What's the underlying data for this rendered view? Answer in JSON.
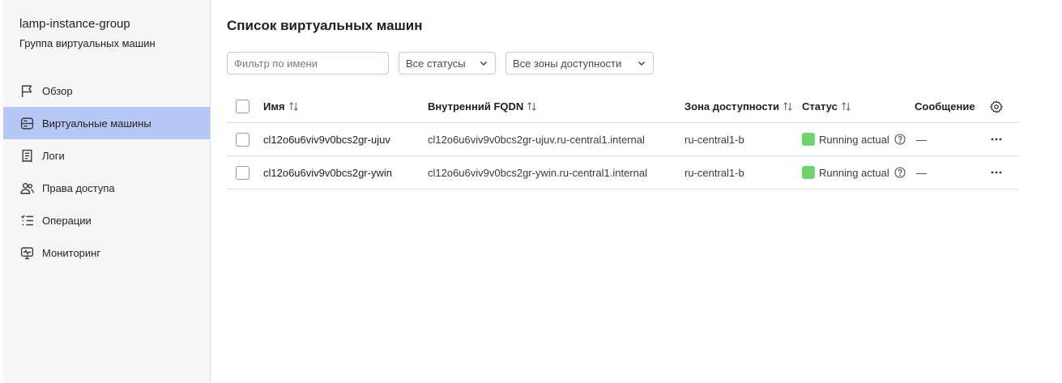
{
  "sidebar": {
    "title": "lamp-instance-group",
    "subtitle": "Группа виртуальных машин",
    "items": [
      {
        "label": "Обзор",
        "icon": "flag-icon",
        "active": false
      },
      {
        "label": "Виртуальные машины",
        "icon": "server-icon",
        "active": true
      },
      {
        "label": "Логи",
        "icon": "logs-icon",
        "active": false
      },
      {
        "label": "Права доступа",
        "icon": "users-icon",
        "active": false
      },
      {
        "label": "Операции",
        "icon": "operations-icon",
        "active": false
      },
      {
        "label": "Мониторинг",
        "icon": "monitoring-icon",
        "active": false
      }
    ]
  },
  "main": {
    "title": "Список виртуальных машин",
    "filters": {
      "name_placeholder": "Фильтр по имени",
      "name_value": "",
      "status_selected": "Все статусы",
      "zone_selected": "Все зоны доступности"
    },
    "table": {
      "columns": {
        "name": "Имя",
        "fqdn": "Внутренний FQDN",
        "zone": "Зона доступности",
        "status": "Статус",
        "message": "Сообщение"
      },
      "rows": [
        {
          "name": "cl12o6u6viv9v0bcs2gr-ujuv",
          "fqdn": "cl12o6u6viv9v0bcs2gr-ujuv.ru-central1.internal",
          "zone": "ru-central1-b",
          "status": "Running actual",
          "message": "—"
        },
        {
          "name": "cl12o6u6viv9v0bcs2gr-ywin",
          "fqdn": "cl12o6u6viv9v0bcs2gr-ywin.ru-central1.internal",
          "zone": "ru-central1-b",
          "status": "Running actual",
          "message": "—"
        }
      ]
    }
  },
  "colors": {
    "active_nav": "#b7c8f6",
    "status_running": "#6fd36f"
  }
}
